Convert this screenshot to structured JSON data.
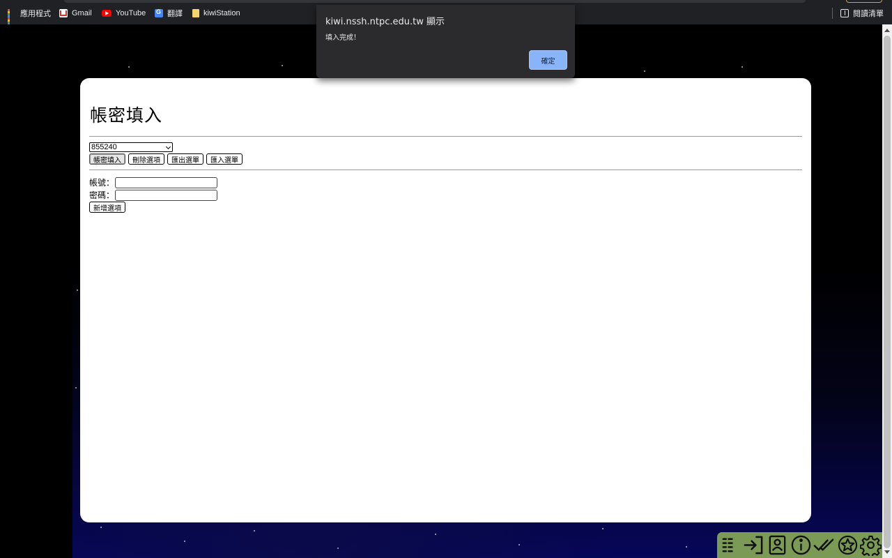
{
  "bookmarks_bar": {
    "items": [
      {
        "label": "應用程式",
        "icon": "apps-grid-icon"
      },
      {
        "label": "Gmail",
        "icon": "gmail-icon"
      },
      {
        "label": "YouTube",
        "icon": "youtube-icon"
      },
      {
        "label": "翻譯",
        "icon": "translate-icon"
      },
      {
        "label": "kiwiStation",
        "icon": "folder-icon"
      }
    ],
    "reading_list": {
      "label": "閱讀清單",
      "icon": "reading-list-icon"
    }
  },
  "page": {
    "title": "帳密填入",
    "account_select": {
      "selected": "855240"
    },
    "buttons": {
      "fill": "帳密填入",
      "delete": "刪除選項",
      "export": "匯出選單",
      "import": "匯入選單"
    },
    "form": {
      "account_label": "帳號：",
      "account_value": "",
      "password_label": "密碼：",
      "password_value": "",
      "add_button": "新增選項"
    }
  },
  "alert": {
    "origin": "kiwi.nssh.ntpc.edu.tw 顯示",
    "message": "填入完成！",
    "ok_label": "確定"
  },
  "toolbar": {
    "icons": [
      "list-icon",
      "login-icon",
      "contact-card-icon",
      "info-icon",
      "double-check-icon",
      "star-icon",
      "gear-icon"
    ],
    "color": "#7a9a55"
  }
}
